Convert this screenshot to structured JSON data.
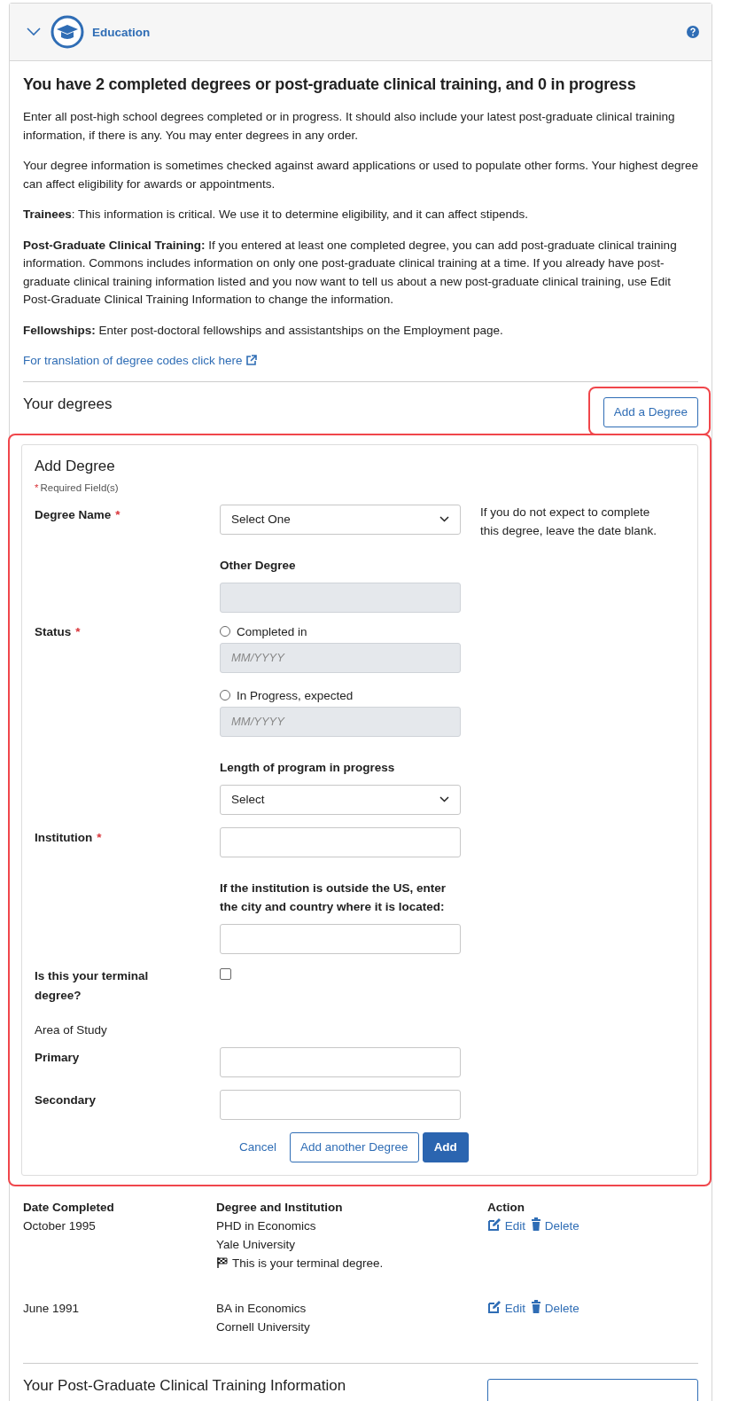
{
  "panel": {
    "title": "Education",
    "expanded": true
  },
  "summary": {
    "heading": "You have 2 completed degrees or post-graduate clinical training, and 0 in progress",
    "paragraphs": [
      "Enter all post-high school degrees completed or in progress. It should also include your latest post-graduate clinical training information, if there is any. You may enter degrees in any order.",
      "Your degree information is sometimes checked against award applications or used to populate other forms. Your highest degree can affect eligibility for awards or appointments.",
      "**Trainees**: This information is critical. We use it to determine eligibility, and it can affect stipends.",
      "**Post-Graduate Clinical Training:** If you entered at least one completed degree, you can add post-graduate clinical training information. Commons includes information on only one post-graduate clinical training at a time. If you already have post-graduate clinical training information listed and you now want to tell us about a new post-graduate clinical training, use Edit Post-Graduate Clinical Training Information to change the information.",
      "**Fellowships:** Enter post-doctoral fellowships and assistantships on the Employment page."
    ],
    "link": "For translation of degree codes click here"
  },
  "degrees_section": {
    "heading": "Your degrees",
    "add_button": "Add a Degree",
    "highlighted": true
  },
  "form": {
    "title": "Add Degree",
    "required_mark": "*",
    "required_note": "Required Field(s)",
    "highlighted": true,
    "hint": "If you do not expect to complete this degree, leave the date blank.",
    "rows": [
      {
        "kind": "select",
        "label": "Degree Name",
        "required": true,
        "value": "Select One"
      },
      {
        "kind": "input",
        "sublabel": "Other Degree",
        "disabled": true
      },
      {
        "kind": "radio",
        "label": "Status",
        "required": true,
        "options": [
          {
            "label": "Completed in",
            "selected": false,
            "placeholder": "MM/YYYY",
            "disabled": true
          },
          {
            "label": "In Progress, expected",
            "selected": false,
            "placeholder": "MM/YYYY",
            "disabled": true
          }
        ]
      },
      {
        "kind": "select",
        "sublabel": "Length of program in progress",
        "value": "Select"
      },
      {
        "kind": "input",
        "label": "Institution",
        "required": true,
        "disabled": false
      },
      {
        "kind": "input",
        "sublabel": "If the institution is outside the US, enter the city and country where it is located:",
        "disabled": false
      },
      {
        "kind": "checkbox",
        "label": "Is this your terminal degree?",
        "checked": false
      },
      {
        "kind": "heading",
        "label": "Area of Study"
      },
      {
        "kind": "input",
        "label": "Primary",
        "disabled": false
      },
      {
        "kind": "input",
        "label": "Secondary",
        "disabled": false
      }
    ],
    "buttons": [
      {
        "kind": "link",
        "label": "Cancel"
      },
      {
        "kind": "secondary",
        "label": "Add another Degree"
      },
      {
        "kind": "primary",
        "label": "Add"
      }
    ]
  },
  "degrees_table": {
    "columns": [
      "Date Completed",
      "Degree and Institution",
      "Action"
    ],
    "rows": [
      {
        "date": "October 1995",
        "degree": "PHD in Economics",
        "institution": "Yale University",
        "terminal": true,
        "terminal_note": "This is your terminal degree.",
        "actions": [
          "Edit",
          "Delete"
        ]
      },
      {
        "date": "June 1991",
        "degree": "BA in Economics",
        "institution": "Cornell University",
        "terminal": false,
        "actions": [
          "Edit",
          "Delete"
        ]
      }
    ]
  },
  "clinical_section": {
    "heading": "Your Post-Graduate Clinical Training Information"
  }
}
